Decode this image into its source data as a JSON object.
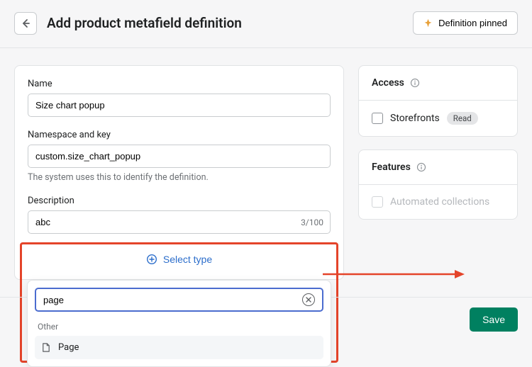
{
  "header": {
    "title": "Add product metafield definition",
    "pinned_label": "Definition pinned"
  },
  "form": {
    "name_label": "Name",
    "name_value": "Size chart popup",
    "nskey_label": "Namespace and key",
    "nskey_value": "custom.size_chart_popup",
    "nskey_helper": "The system uses this to identify the definition.",
    "desc_label": "Description",
    "desc_value": "abc",
    "desc_counter": "3/100",
    "select_type_label": "Select type",
    "search_value": "page",
    "group_label": "Other",
    "option_label": "Page"
  },
  "access": {
    "title": "Access",
    "storefronts_label": "Storefronts",
    "read_badge": "Read"
  },
  "features": {
    "title": "Features",
    "auto_label": "Automated collections"
  },
  "footer": {
    "save_label": "Save"
  }
}
